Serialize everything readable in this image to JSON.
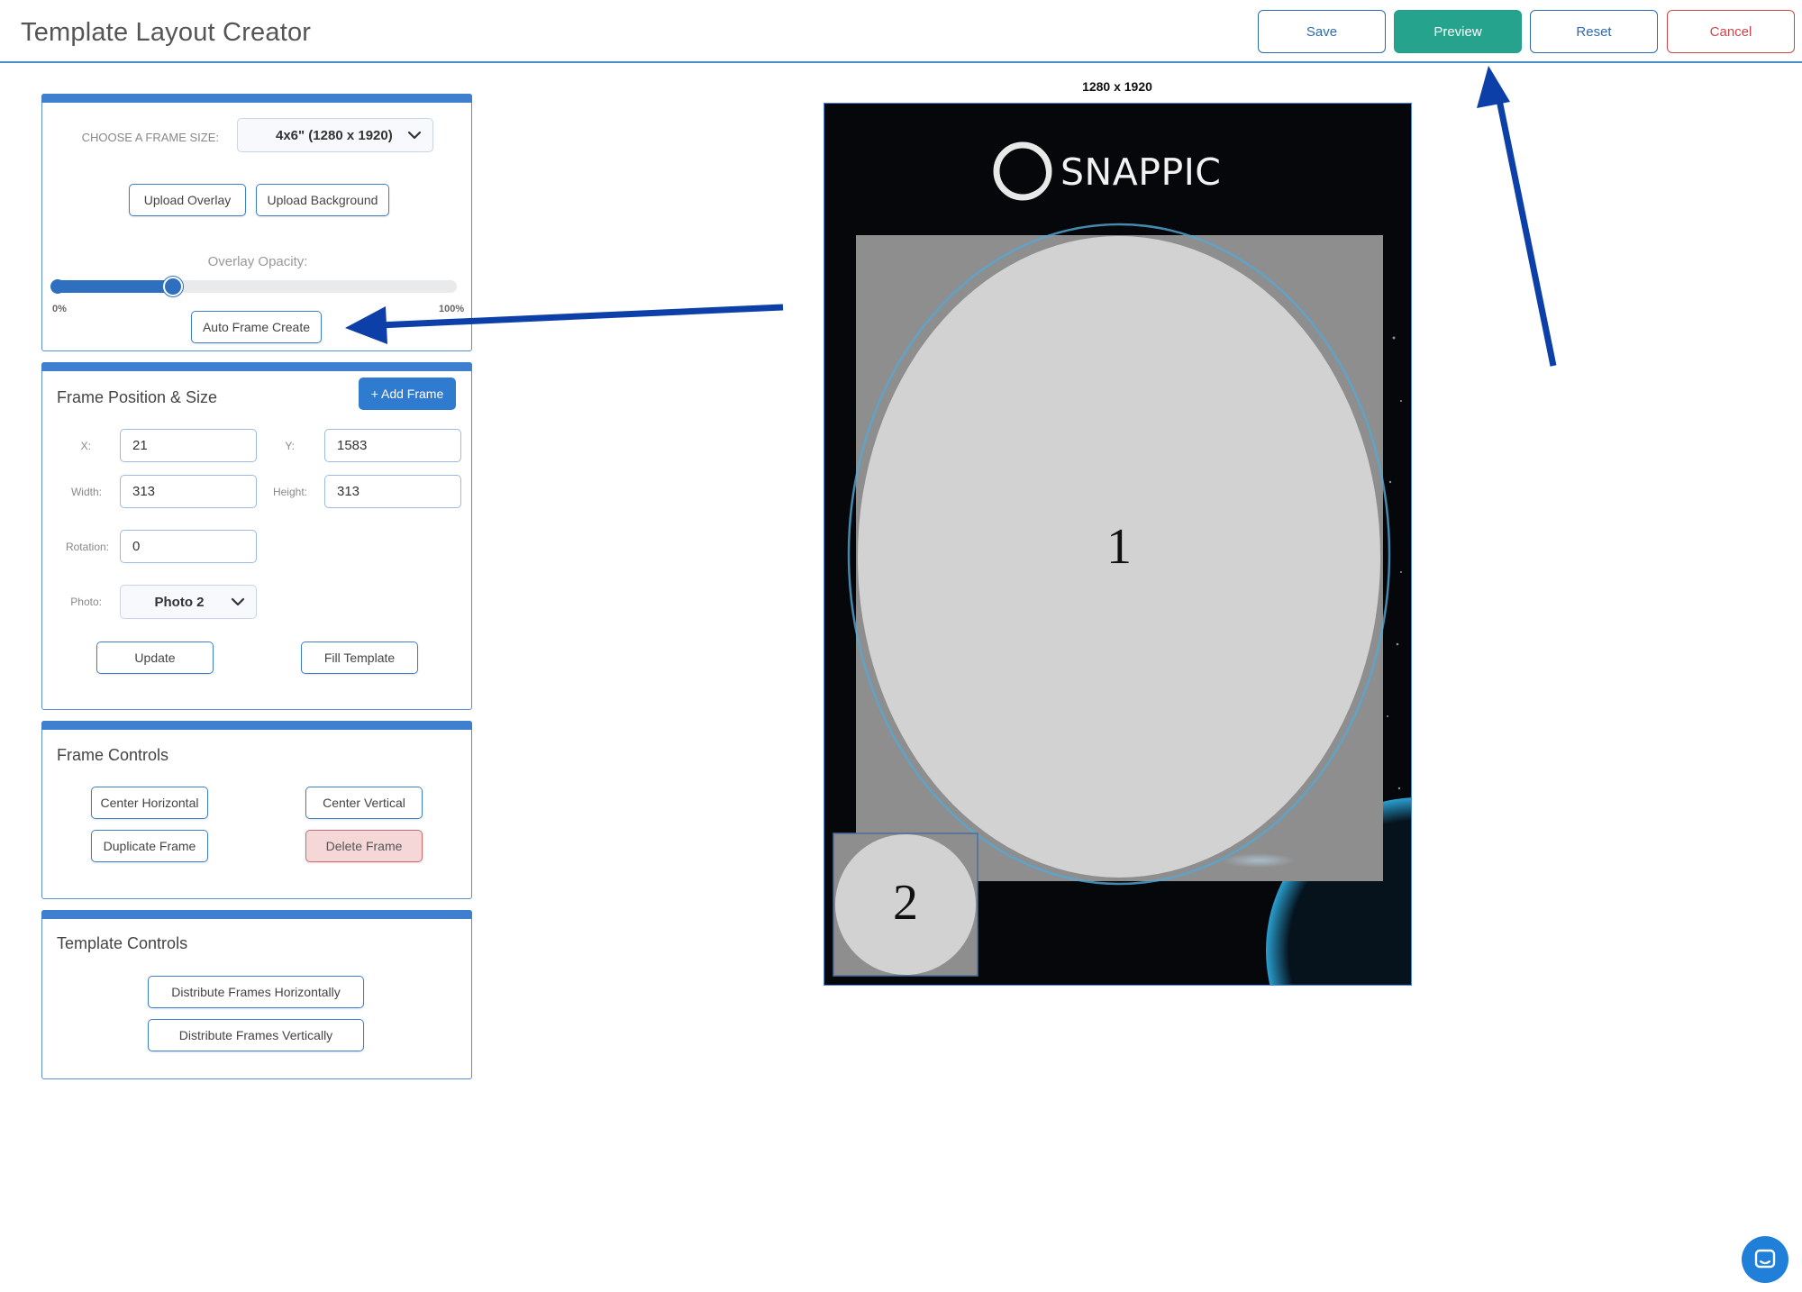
{
  "header": {
    "title": "Template Layout Creator",
    "save_label": "Save",
    "preview_label": "Preview",
    "reset_label": "Reset",
    "cancel_label": "Cancel"
  },
  "frame_size_panel": {
    "choose_label": "CHOOSE A FRAME SIZE:",
    "selected_size": "4x6\" (1280 x 1920)",
    "upload_overlay_label": "Upload Overlay",
    "upload_background_label": "Upload Background",
    "opacity_label": "Overlay Opacity:",
    "opacity_min_label": "0%",
    "opacity_max_label": "100%",
    "opacity_value_fraction": 0.3,
    "auto_frame_label": "Auto Frame Create"
  },
  "frame_position_panel": {
    "title": "Frame Position & Size",
    "add_frame_label": "+ Add Frame",
    "x_label": "X:",
    "x_value": "21",
    "y_label": "Y:",
    "y_value": "1583",
    "width_label": "Width:",
    "width_value": "313",
    "height_label": "Height:",
    "height_value": "313",
    "rotation_label": "Rotation:",
    "rotation_value": "0",
    "photo_label": "Photo:",
    "photo_value": "Photo 2",
    "update_label": "Update",
    "fill_template_label": "Fill Template"
  },
  "frame_controls_panel": {
    "title": "Frame Controls",
    "center_horizontal_label": "Center Horizontal",
    "center_vertical_label": "Center Vertical",
    "duplicate_frame_label": "Duplicate Frame",
    "delete_frame_label": "Delete Frame"
  },
  "template_controls_panel": {
    "title": "Template Controls",
    "distribute_horizontal_label": "Distribute Frames Horizontally",
    "distribute_vertical_label": "Distribute Frames Vertically"
  },
  "canvas": {
    "size_label": "1280 x 1920",
    "logo_text": "SNAPPIC",
    "frame_1_label": "1",
    "frame_2_label": "2"
  },
  "colors": {
    "accent": "#2f7bcf",
    "preview": "#26a38c",
    "cancel": "#d0464a",
    "annotation_arrow": "#0d3fa8"
  },
  "icons": {
    "chat": "chat-icon",
    "dropdown": "chevron-down-icon"
  }
}
